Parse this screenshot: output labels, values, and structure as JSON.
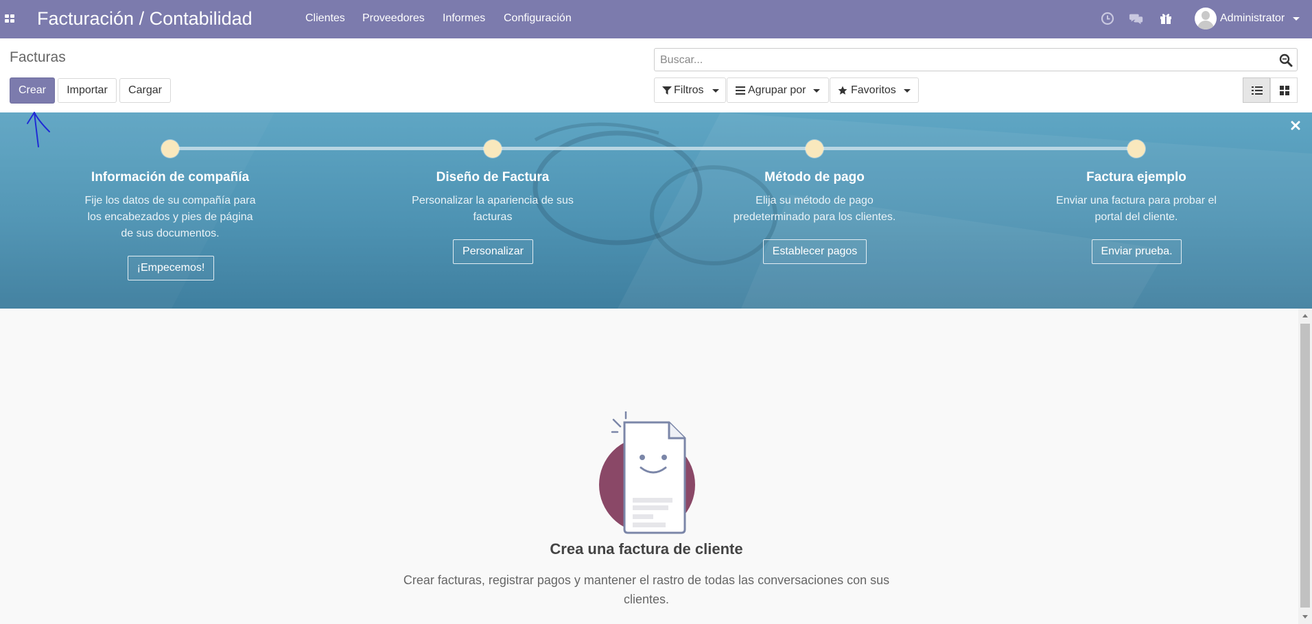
{
  "navbar": {
    "app_title": "Facturación / Contabilidad",
    "menu": [
      "Clientes",
      "Proveedores",
      "Informes",
      "Configuración"
    ],
    "user_name": "Administrator",
    "icons": [
      "apps-icon",
      "clock-icon",
      "chat-icon",
      "gift-icon",
      "avatar",
      "caret-down-icon"
    ],
    "color": "#7c7bad"
  },
  "control_panel": {
    "breadcrumb": "Facturas",
    "buttons": {
      "create": "Crear",
      "import": "Importar",
      "upload": "Cargar"
    },
    "search": {
      "placeholder": "Buscar...",
      "value": ""
    },
    "filters": {
      "filters": "Filtros",
      "group_by": "Agrupar por",
      "favorites": "Favoritos"
    },
    "views": [
      "list-view",
      "kanban-view"
    ],
    "active_view": "list-view"
  },
  "onboarding": {
    "steps": [
      {
        "title": "Información de compañía",
        "desc": [
          "Fije los datos de su compañía para",
          "los encabezados y pies de página",
          "de sus documentos."
        ],
        "action": "¡Empecemos!"
      },
      {
        "title": "Diseño de Factura",
        "desc": [
          "Personalizar la apariencia de sus",
          "facturas"
        ],
        "action": "Personalizar"
      },
      {
        "title": "Método de pago",
        "desc": [
          "Elija su método de pago",
          "predeterminado para los clientes."
        ],
        "action": "Establecer pagos"
      },
      {
        "title": "Factura ejemplo",
        "desc": [
          "Enviar una factura para probar el",
          "portal del cliente."
        ],
        "action": "Enviar prueba."
      }
    ]
  },
  "empty_state": {
    "title": "Crea una factura de cliente",
    "text": [
      "Crear facturas, registrar pagos y mantener el rastro de todas las conversaciones con sus",
      "clientes."
    ]
  }
}
